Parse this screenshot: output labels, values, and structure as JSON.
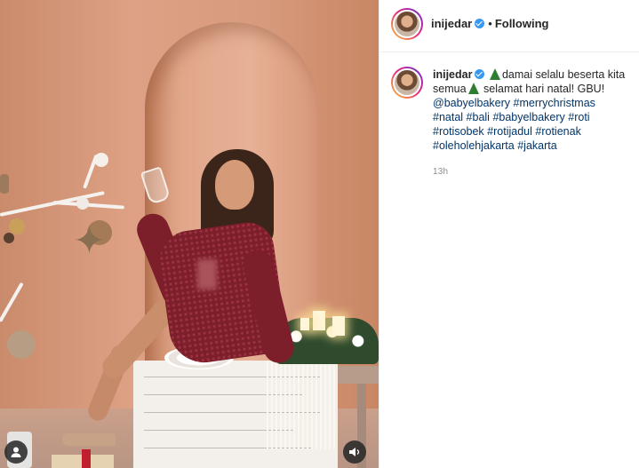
{
  "media": {
    "sound_icon": "speaker-icon",
    "user_tag_icon": "user-icon"
  },
  "header": {
    "username": "inijedar",
    "separator": "•",
    "follow_status": "Following"
  },
  "caption": {
    "username": "inijedar",
    "line1": "damai selalu beserta kita semua",
    "line2": "selamat hari natal! GBU!",
    "mention": "@babyelbakery",
    "tags": [
      "#merrychristmas",
      "#natal",
      "#bali",
      "#babyelbakery",
      "#roti",
      "#rotisobek",
      "#rotijadul",
      "#rotienak",
      "#oleholehjakarta",
      "#jakarta"
    ],
    "time": "13h"
  },
  "colors": {
    "link": "#003569",
    "verified": "#3897f0",
    "muted": "#8e8e8e"
  }
}
